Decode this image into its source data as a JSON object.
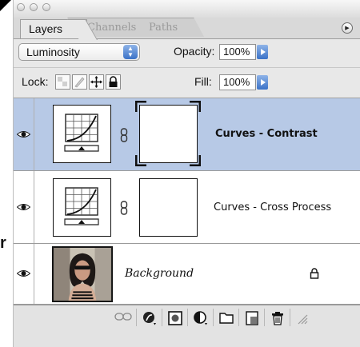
{
  "window": {
    "tabs": [
      {
        "label": "Layers",
        "active": true
      },
      {
        "label": "Channels",
        "active": false
      },
      {
        "label": "Paths",
        "active": false
      }
    ],
    "menu_icon": "flyout-menu-icon"
  },
  "blend": {
    "mode": "Luminosity",
    "opacity_label": "Opacity:",
    "opacity_value": "100%"
  },
  "lock": {
    "label": "Lock:",
    "fill_label": "Fill:",
    "fill_value": "100%"
  },
  "layers": [
    {
      "name": "Curves - Contrast",
      "selected": true,
      "type": "adjustment"
    },
    {
      "name": "Curves - Cross Process",
      "selected": false,
      "type": "adjustment"
    },
    {
      "name": "Background",
      "selected": false,
      "type": "image",
      "locked": true
    }
  ],
  "stray_text": "r",
  "colors": {
    "selected_row": "#b7c9e6",
    "accent_blue": "#3b72c7"
  }
}
